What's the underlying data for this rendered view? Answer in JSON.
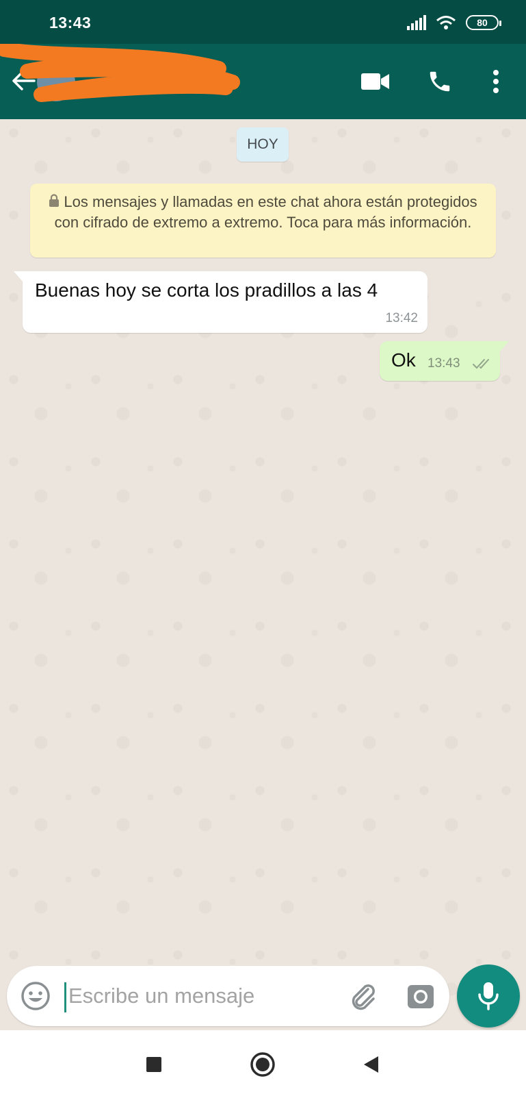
{
  "status_bar": {
    "time": "13:43",
    "battery": "80"
  },
  "header": {
    "contact_name": "",
    "icons": [
      "back-arrow-icon",
      "video-call-icon",
      "phone-icon",
      "more-vertical-icon"
    ],
    "colors": {
      "app_bar": "#075e54",
      "status_bar": "#054d44",
      "redaction": "#f47a22"
    }
  },
  "chat": {
    "date_chip": "HOY",
    "encryption_notice": "Los mensajes y llamadas en este chat ahora están protegidos con cifrado de extremo a extremo. Toca para más información.",
    "messages": [
      {
        "direction": "incoming",
        "text": "Buenas hoy se corta los pradillos a las 4",
        "time": "13:42"
      },
      {
        "direction": "outgoing",
        "text": "Ok",
        "time": "13:43",
        "status": "delivered-double-check"
      }
    ],
    "colors": {
      "background": "#ece5dd",
      "incoming": "#ffffff",
      "outgoing": "#dcf8c6",
      "notice": "#fdf4c5"
    }
  },
  "composer": {
    "placeholder": "Escribe un mensaje",
    "value": "",
    "icons": [
      "emoji-icon",
      "paperclip-icon",
      "camera-icon",
      "microphone-icon"
    ],
    "accent": "#128c7e"
  },
  "nav_bar": {
    "icons": [
      "recents-square-icon",
      "home-circle-icon",
      "back-triangle-icon"
    ]
  }
}
